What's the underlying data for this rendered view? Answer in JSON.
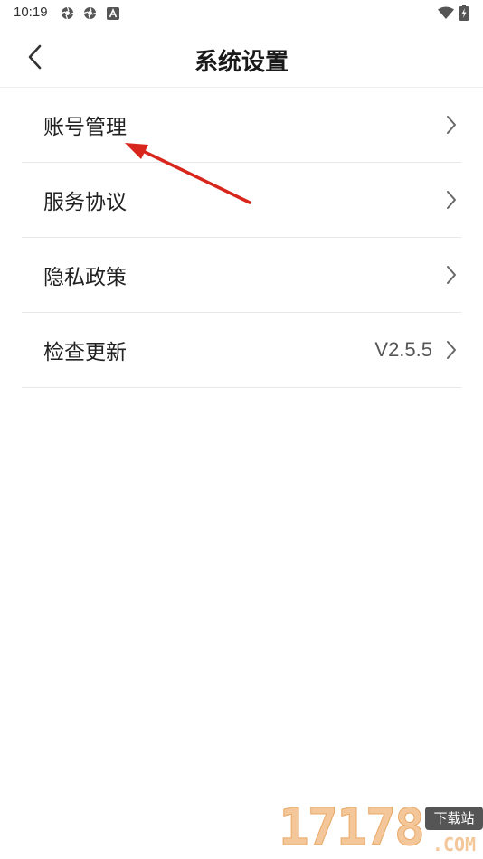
{
  "status_bar": {
    "time": "10:19",
    "icons_left": [
      "aperture-icon",
      "aperture-icon",
      "android-notification-icon"
    ],
    "icons_right": [
      "wifi-icon",
      "battery-charging-icon"
    ]
  },
  "header": {
    "back_icon": "chevron-left-icon",
    "title": "系统设置"
  },
  "settings": [
    {
      "label": "账号管理",
      "value": ""
    },
    {
      "label": "服务协议",
      "value": ""
    },
    {
      "label": "隐私政策",
      "value": ""
    },
    {
      "label": "检查更新",
      "value": "V2.5.5"
    }
  ],
  "annotation": {
    "color": "#d9261c",
    "points_to": "账号管理"
  },
  "watermark": {
    "digits": [
      "1",
      "7",
      "1",
      "7",
      "8"
    ],
    "badge": "下载站",
    "domain": ".COM",
    "color": "#f3c79a"
  }
}
